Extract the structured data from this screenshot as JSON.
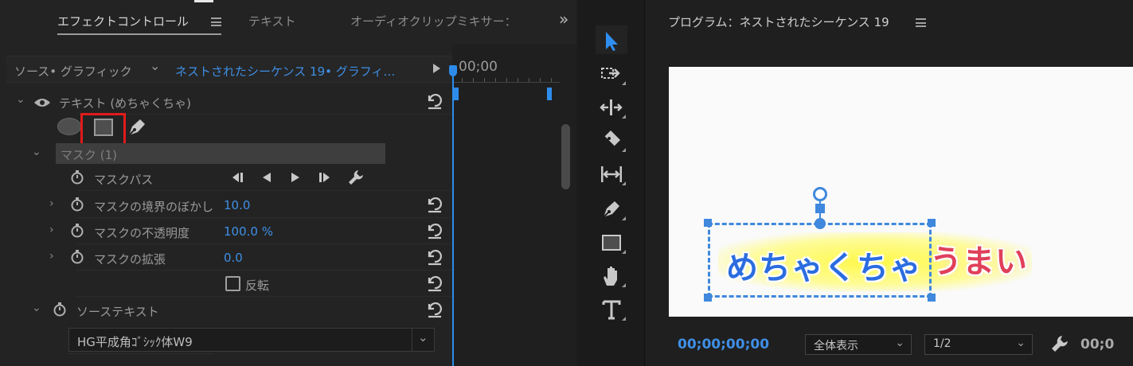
{
  "effect_controls": {
    "tabs": [
      {
        "label": "エフェクトコントロール",
        "active": true
      },
      {
        "label": "テキスト",
        "active": false
      },
      {
        "label": "オーディオクリップミキサー：",
        "active": false
      }
    ],
    "overflow_icon": "»",
    "source_label": "ソース• グラフィック",
    "sequence_label": "ネストされたシーケンス 19• グラフィ…",
    "timecode": "00;00",
    "text_layer_label": "テキスト (めちゃくちゃ)",
    "mask_group_label": "マスク (1)",
    "mask_path_label": "マスクパス",
    "feather_label": "マスクの境界のぼかし",
    "feather_value": "10.0",
    "opacity_label": "マスクの不透明度",
    "opacity_value": "100.0 %",
    "expansion_label": "マスクの拡張",
    "expansion_value": "0.0",
    "invert_label": "反転",
    "invert_checked": false,
    "source_text_label": "ソーステキスト",
    "font_name": "HG平成角ｺﾞｼｯｸ体W9"
  },
  "tools": [
    {
      "name": "selection-tool-icon",
      "active": true
    },
    {
      "name": "track-select-forward-icon"
    },
    {
      "name": "ripple-edit-icon"
    },
    {
      "name": "razor-icon"
    },
    {
      "name": "slip-icon"
    },
    {
      "name": "pen-icon"
    },
    {
      "name": "rectangle-icon"
    },
    {
      "name": "hand-icon"
    },
    {
      "name": "type-icon"
    }
  ],
  "program_monitor": {
    "title": "プログラム：ネストされたシーケンス 19",
    "timecode": "00;00;00;00",
    "fit_label": "全体表示",
    "resolution_label": "1/2",
    "duration_fragment": "00;0",
    "caption_left": "めちゃくちゃ",
    "caption_right": "うまい"
  },
  "colors": {
    "accent_blue": "#3f8fe6",
    "highlight_red": "#e11b1b",
    "panel_bg": "#232323"
  }
}
